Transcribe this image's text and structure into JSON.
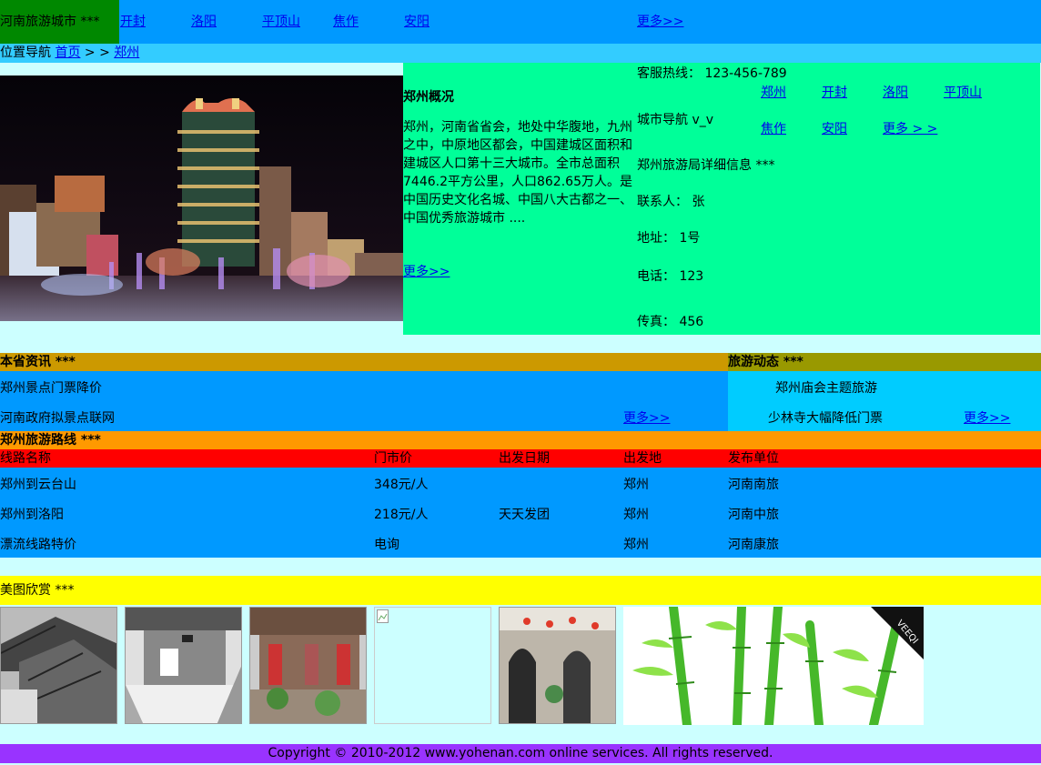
{
  "header": {
    "site_title": "河南旅游城市 ***",
    "nav": [
      "开封",
      "洛阳",
      "平顶山",
      "焦作",
      "安阳"
    ],
    "more": "更多>>"
  },
  "breadcrumb": {
    "label": "位置导航",
    "home": "首页",
    "sep": " > > ",
    "current": "郑州"
  },
  "overview": {
    "title": "郑州概况",
    "text": "郑州，河南省省会，地处中华腹地，九州之中，中原地区都会，中国建城区面积和建城区人口第十三大城市。全市总面积7446.2平方公里，人口862.65万人。是中国历史文化名城、中国八大古都之一、中国优秀旅游城市 ....",
    "more": "更多>>"
  },
  "info": {
    "hotline": "客服热线：  123-456-789",
    "city_nav_label": "城市导航 v_v",
    "bureau": "郑州旅游局详细信息 ***",
    "contact": "联系人： 张",
    "address": "地址： 1号",
    "phone": "电话： 123",
    "fax": "传真： 456",
    "city_links": [
      "郑州",
      "开封",
      "洛阳",
      "平顶山",
      "焦作",
      "安阳"
    ],
    "city_more": "更多 > >"
  },
  "news": {
    "title": "本省资讯 ***",
    "items": [
      "郑州景点门票降价",
      "河南政府拟景点联网"
    ],
    "more": "更多>>"
  },
  "trends": {
    "title": "旅游动态 ***",
    "items": [
      "郑州庙会主题旅游",
      "少林寺大幅降低门票"
    ],
    "more": "更多>>"
  },
  "routes": {
    "title": "郑州旅游路线 ***",
    "headers": [
      "线路名称",
      "门市价",
      "出发日期",
      "出发地",
      "发布单位"
    ],
    "rows": [
      [
        "郑州到云台山",
        "348元/人",
        "",
        "郑州",
        "河南南旅"
      ],
      [
        "郑州到洛阳",
        "218元/人",
        "天天发团",
        "郑州",
        "河南中旅"
      ],
      [
        "漂流线路特价",
        "电询",
        "",
        "郑州",
        "河南康旅"
      ]
    ]
  },
  "gallery": {
    "title": "美图欣赏 ***",
    "bamboo_logo": "VEEQI"
  },
  "footer": {
    "text": "Copyright © 2010-2012 www.yohenan.com online services. All rights reserved."
  }
}
